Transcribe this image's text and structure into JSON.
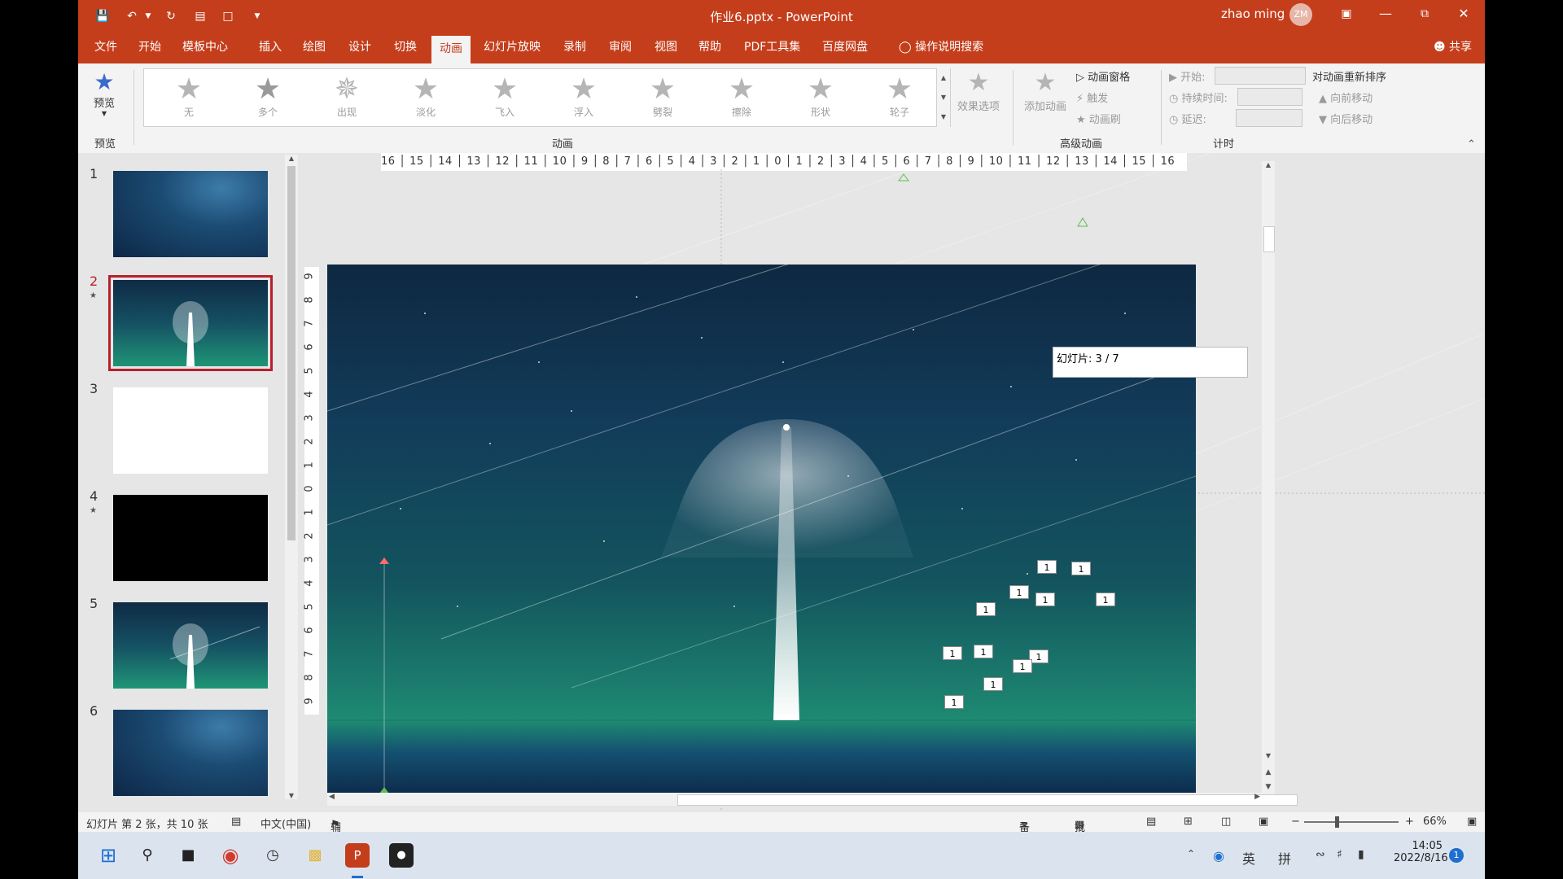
{
  "titlebar": {
    "title": "作业6.pptx  -  PowerPoint",
    "user": "zhao ming",
    "avatar_initials": "ZM"
  },
  "tabs": [
    "文件",
    "开始",
    "模板中心",
    "插入",
    "绘图",
    "设计",
    "切换",
    "动画",
    "幻灯片放映",
    "录制",
    "审阅",
    "视图",
    "帮助",
    "PDF工具集",
    "百度网盘"
  ],
  "active_tab": "动画",
  "tell_me": "操作说明搜索",
  "share": "共享",
  "ribbon": {
    "preview_label": "预览",
    "preview_group": "预览",
    "animations_group": "动画",
    "advanced_group": "高级动画",
    "timing_group": "计时",
    "gallery": [
      "无",
      "多个",
      "出现",
      "淡化",
      "飞入",
      "浮入",
      "劈裂",
      "擦除",
      "形状",
      "轮子"
    ],
    "effect_options": "效果选项",
    "add_animation": "添加动画",
    "animation_pane": "动画窗格",
    "trigger": "触发",
    "animation_painter": "动画刷",
    "start": "开始:",
    "duration": "持续时间:",
    "delay": "延迟:",
    "reorder": "对动画重新排序",
    "move_earlier": "向前移动",
    "move_later": "向后移动"
  },
  "thumbnails": [
    {
      "num": "1",
      "style": "blue",
      "star": false
    },
    {
      "num": "2",
      "style": "spotlight",
      "star": true,
      "selected": true
    },
    {
      "num": "3",
      "style": "white",
      "star": false
    },
    {
      "num": "4",
      "style": "black",
      "star": true
    },
    {
      "num": "5",
      "style": "spotlight",
      "star": false
    },
    {
      "num": "6",
      "style": "blue",
      "star": false
    }
  ],
  "ruler_h": "16 │ 15 │ 14 │ 13 │ 12 │ 11 │ 10 │ 9 │ 8 │ 7 │ 6 │ 5 │ 4 │ 3 │ 2 │ 1 │ 0 │ 1 │ 2 │ 3 │ 4 │ 5 │ 6 │ 7 │ 8 │ 9 │ 10 │ 11 │ 12 │ 13 │ 14 │ 15 │ 16",
  "ruler_v": [
    "9",
    "8",
    "7",
    "6",
    "5",
    "4",
    "3",
    "2",
    "1",
    "0",
    "1",
    "2",
    "3",
    "4",
    "5",
    "6",
    "7",
    "8",
    "9"
  ],
  "popup": "幻灯片: 3 / 7",
  "tags": [
    "1",
    "1",
    "1",
    "1",
    "1",
    "1",
    "1",
    "1",
    "1",
    "1",
    "1",
    "1"
  ],
  "status": {
    "slide_info": "幻灯片 第 2 张，共 10 张",
    "language": "中文(中国)",
    "accessibility": "辅助功能: 调查",
    "notes": "备注",
    "comments": "批注",
    "zoom": "66%"
  },
  "taskbar": {
    "ime_en": "英",
    "ime_pinyin": "拼",
    "time": "14:05",
    "date": "2022/8/16",
    "notif": "1"
  },
  "colors": {
    "brand": "#c43e1c",
    "selected_thumb": "#b7202b"
  }
}
